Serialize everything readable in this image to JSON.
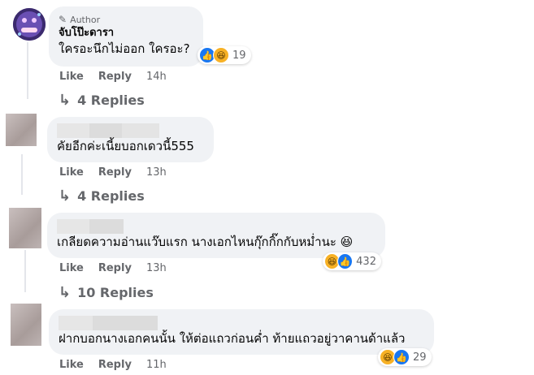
{
  "comments": [
    {
      "badge": "Author",
      "name": "จับโป๊ะดารา",
      "text": "ใครอะนึกไม่ออก ใครอะ?",
      "reaction_count": "19",
      "actions": {
        "like": "Like",
        "reply": "Reply",
        "time": "14h"
      },
      "replies_label": "4 Replies"
    },
    {
      "text": "คัยอีกค่ะเนี้ยบอกเดวนี้555",
      "actions": {
        "like": "Like",
        "reply": "Reply",
        "time": "13h"
      },
      "replies_label": "4 Replies"
    },
    {
      "text": "เกลียดความอ่านแว๊บแรก นางเอกไหนกุ๊กกิ๊กกับหม่ำนะ 😆",
      "reaction_count": "432",
      "actions": {
        "like": "Like",
        "reply": "Reply",
        "time": "13h"
      },
      "replies_label": "10 Replies"
    },
    {
      "text": "ฝากบอกนางเอกคนนั้น ให้ต่อแถวก่อนค่ำ ท้ายแถวอยู่วาคานด้าแล้ว",
      "reaction_count": "29",
      "actions": {
        "like": "Like",
        "reply": "Reply",
        "time": "11h"
      }
    }
  ],
  "icons": {
    "reply_arrow": "↳",
    "pencil": "✎",
    "like": "👍",
    "haha": "😆"
  },
  "colors": {
    "bubble": "#f0f2f5",
    "like_blue": "#1877f2",
    "haha_yellow": "#f7b125",
    "meta_gray": "#65676b"
  }
}
